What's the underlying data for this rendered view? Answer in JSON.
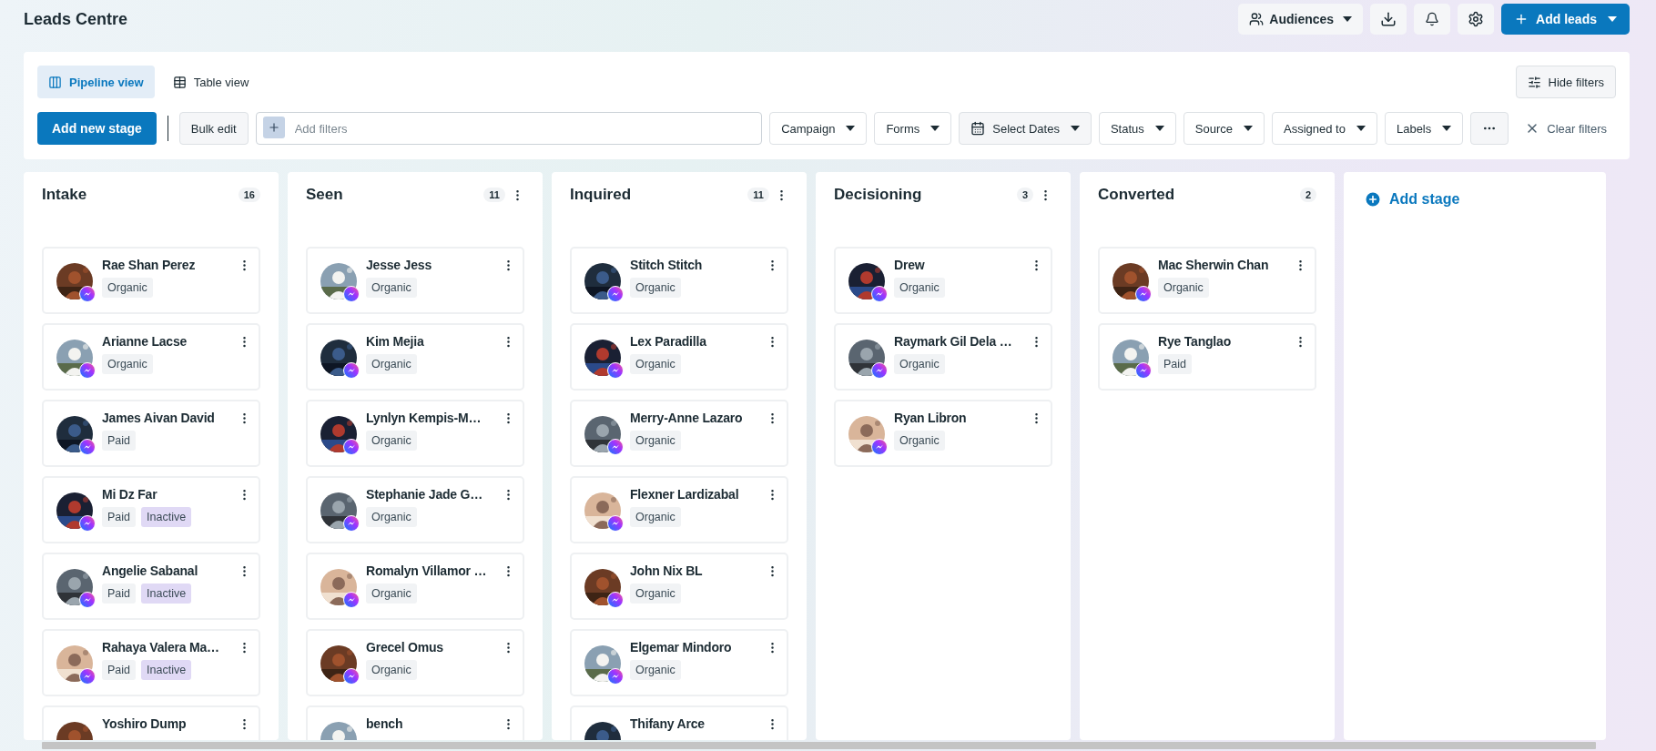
{
  "header": {
    "title": "Leads Centre",
    "audiences_button": "Audiences",
    "add_leads_button": "Add leads"
  },
  "views": [
    {
      "label": "Pipeline view",
      "kind": "pipeline",
      "selected": true
    },
    {
      "label": "Table view",
      "kind": "table",
      "selected": false
    }
  ],
  "hide_filters_button": "Hide filters",
  "toolbar": {
    "add_stage_button": "Add new stage",
    "bulk_edit_button": "Bulk edit",
    "filter_field": {
      "placeholder": "Add filters"
    },
    "filters": [
      {
        "label": "Campaign",
        "kind": "dropdown"
      },
      {
        "label": "Forms",
        "kind": "dropdown"
      },
      {
        "label": "Select Dates",
        "kind": "date"
      },
      {
        "label": "Status",
        "kind": "dropdown"
      },
      {
        "label": "Source",
        "kind": "dropdown"
      },
      {
        "label": "Assigned to",
        "kind": "dropdown"
      },
      {
        "label": "Labels",
        "kind": "dropdown"
      }
    ],
    "clear_filters_button": "Clear filters"
  },
  "stages": [
    {
      "title": "Intake",
      "count": "16",
      "menu": false,
      "leads": [
        {
          "name": "Rae Shan Perez",
          "tags": [
            {
              "label": "Organic",
              "kind": "source"
            }
          ]
        },
        {
          "name": "Arianne Lacse",
          "tags": [
            {
              "label": "Organic",
              "kind": "source"
            }
          ]
        },
        {
          "name": "James Aivan David",
          "tags": [
            {
              "label": "Paid",
              "kind": "source"
            }
          ]
        },
        {
          "name": "Mi Dz Far",
          "tags": [
            {
              "label": "Paid",
              "kind": "source"
            },
            {
              "label": "Inactive",
              "kind": "status"
            }
          ]
        },
        {
          "name": "Angelie Sabanal",
          "tags": [
            {
              "label": "Paid",
              "kind": "source"
            },
            {
              "label": "Inactive",
              "kind": "status"
            }
          ]
        },
        {
          "name": "Rahaya Valera Ma…",
          "tags": [
            {
              "label": "Paid",
              "kind": "source"
            },
            {
              "label": "Inactive",
              "kind": "status"
            }
          ]
        },
        {
          "name": "Yoshiro Dump"
        }
      ]
    },
    {
      "title": "Seen",
      "count": "11",
      "menu": true,
      "leads": [
        {
          "name": "Jesse Jess",
          "tags": [
            {
              "label": "Organic",
              "kind": "source"
            }
          ]
        },
        {
          "name": "Kim Mejia",
          "tags": [
            {
              "label": "Organic",
              "kind": "source"
            }
          ]
        },
        {
          "name": "Lynlyn Kempis-M…",
          "tags": [
            {
              "label": "Organic",
              "kind": "source"
            }
          ]
        },
        {
          "name": "Stephanie Jade G…",
          "tags": [
            {
              "label": "Organic",
              "kind": "source"
            }
          ]
        },
        {
          "name": "Romalyn Villamor …",
          "tags": [
            {
              "label": "Organic",
              "kind": "source"
            }
          ]
        },
        {
          "name": "Grecel Omus",
          "tags": [
            {
              "label": "Organic",
              "kind": "source"
            }
          ]
        },
        {
          "name": "bench"
        }
      ]
    },
    {
      "title": "Inquired",
      "count": "11",
      "menu": true,
      "leads": [
        {
          "name": "Stitch Stitch",
          "tags": [
            {
              "label": "Organic",
              "kind": "source"
            }
          ]
        },
        {
          "name": "Lex Paradilla",
          "tags": [
            {
              "label": "Organic",
              "kind": "source"
            }
          ]
        },
        {
          "name": "Merry-Anne Lazaro",
          "tags": [
            {
              "label": "Organic",
              "kind": "source"
            }
          ]
        },
        {
          "name": "Flexner Lardizabal",
          "tags": [
            {
              "label": "Organic",
              "kind": "source"
            }
          ]
        },
        {
          "name": "John Nix BL",
          "tags": [
            {
              "label": "Organic",
              "kind": "source"
            }
          ]
        },
        {
          "name": "Elgemar Mindoro",
          "tags": [
            {
              "label": "Organic",
              "kind": "source"
            }
          ]
        },
        {
          "name": "Thifany Arce"
        }
      ]
    },
    {
      "title": "Decisioning",
      "count": "3",
      "menu": true,
      "leads": [
        {
          "name": "Drew",
          "tags": [
            {
              "label": "Organic",
              "kind": "source"
            }
          ]
        },
        {
          "name": "Raymark Gil Dela …",
          "tags": [
            {
              "label": "Organic",
              "kind": "source"
            }
          ]
        },
        {
          "name": "Ryan Libron",
          "tags": [
            {
              "label": "Organic",
              "kind": "source"
            }
          ]
        }
      ]
    },
    {
      "title": "Converted",
      "count": "2",
      "menu": false,
      "leads": [
        {
          "name": "Mac Sherwin Chan",
          "tags": [
            {
              "label": "Organic",
              "kind": "source"
            }
          ]
        },
        {
          "name": "Rye Tanglao",
          "tags": [
            {
              "label": "Paid",
              "kind": "source"
            }
          ]
        }
      ]
    }
  ],
  "add_stage_link": "Add stage"
}
